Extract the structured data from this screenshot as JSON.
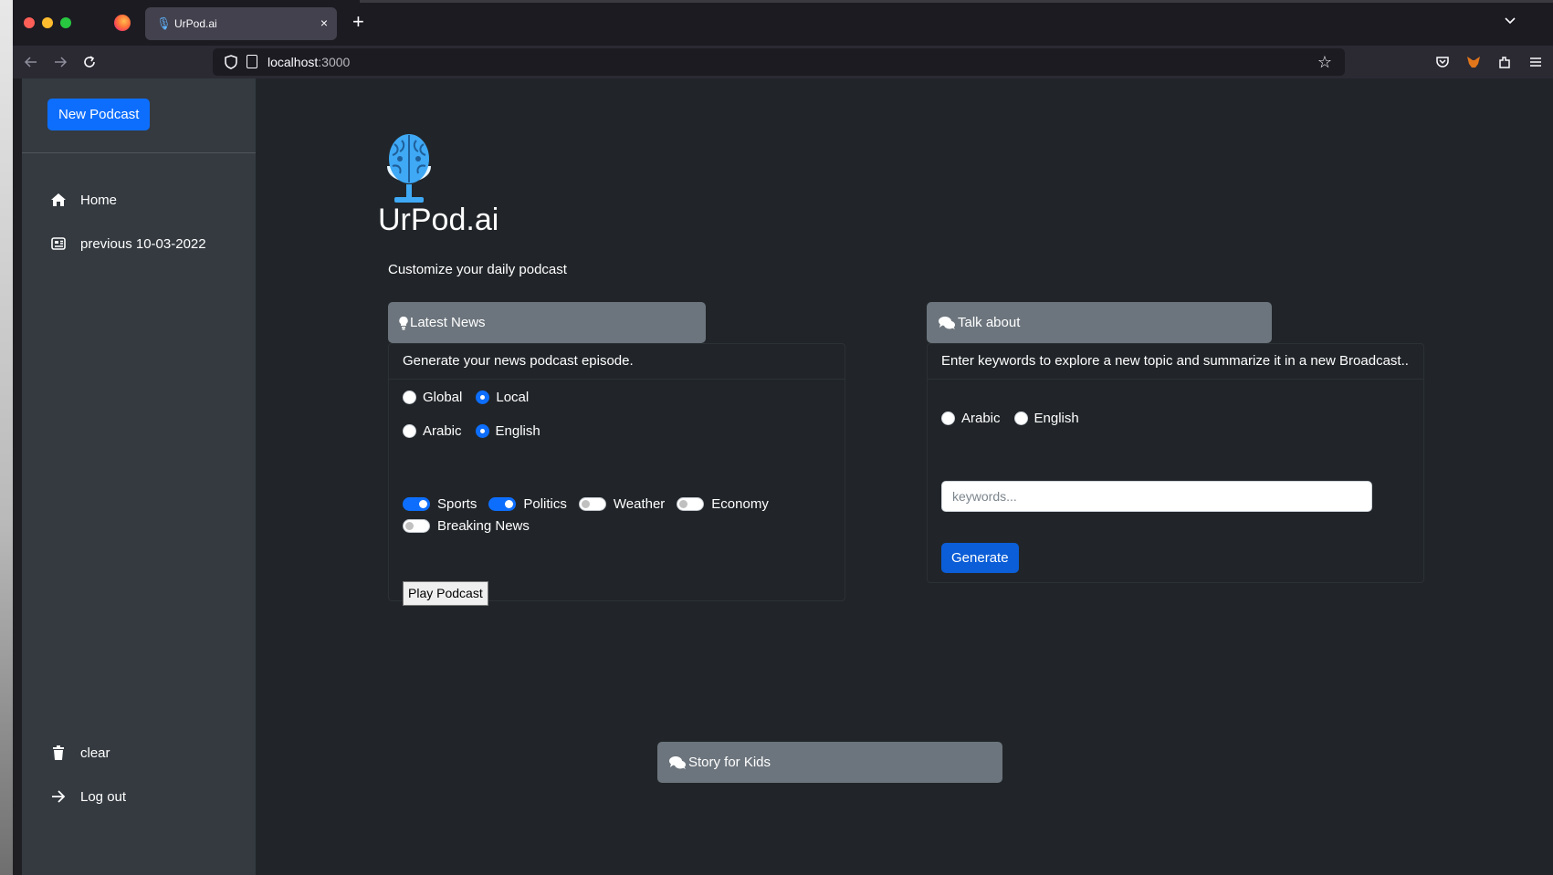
{
  "browser": {
    "tab_title": "UrPod.ai",
    "tab_close": "×",
    "new_tab": "+",
    "url_host": "localhost",
    "url_port": ":3000"
  },
  "sidebar": {
    "new_podcast_label": "New Podcast",
    "items": [
      {
        "label": "Home",
        "icon": "home-icon"
      },
      {
        "label": "previous 10-03-2022",
        "icon": "newspaper-icon"
      }
    ],
    "bottom_items": [
      {
        "label": "clear",
        "icon": "trash-icon"
      },
      {
        "label": "Log out",
        "icon": "arrow-right-icon"
      }
    ]
  },
  "main": {
    "brand": "UrPod.ai",
    "subtitle": "Customize your daily podcast",
    "latest_news": {
      "header": "Latest News",
      "description": "Generate your news podcast episode.",
      "scope_options": [
        {
          "label": "Global",
          "checked": false
        },
        {
          "label": "Local",
          "checked": true
        }
      ],
      "language_options": [
        {
          "label": "Arabic",
          "checked": false
        },
        {
          "label": "English",
          "checked": true
        }
      ],
      "topics": [
        {
          "label": "Sports",
          "on": true
        },
        {
          "label": "Politics",
          "on": true
        },
        {
          "label": "Weather",
          "on": false
        },
        {
          "label": "Economy",
          "on": false
        },
        {
          "label": "Breaking News",
          "on": false
        }
      ],
      "play_label": "Play Podcast"
    },
    "talk_about": {
      "header": "Talk about",
      "description": "Enter keywords to explore a new topic and summarize it in a new Broadcast..",
      "language_options": [
        {
          "label": "Arabic",
          "checked": false
        },
        {
          "label": "English",
          "checked": false
        }
      ],
      "keywords_placeholder": "keywords...",
      "generate_label": "Generate"
    },
    "story_for_kids": {
      "header": "Story for Kids"
    }
  },
  "colors": {
    "primary": "#0d6efd",
    "sidebar_bg": "#343a40",
    "main_bg": "#212529",
    "card_header_bg": "#6c757d"
  }
}
